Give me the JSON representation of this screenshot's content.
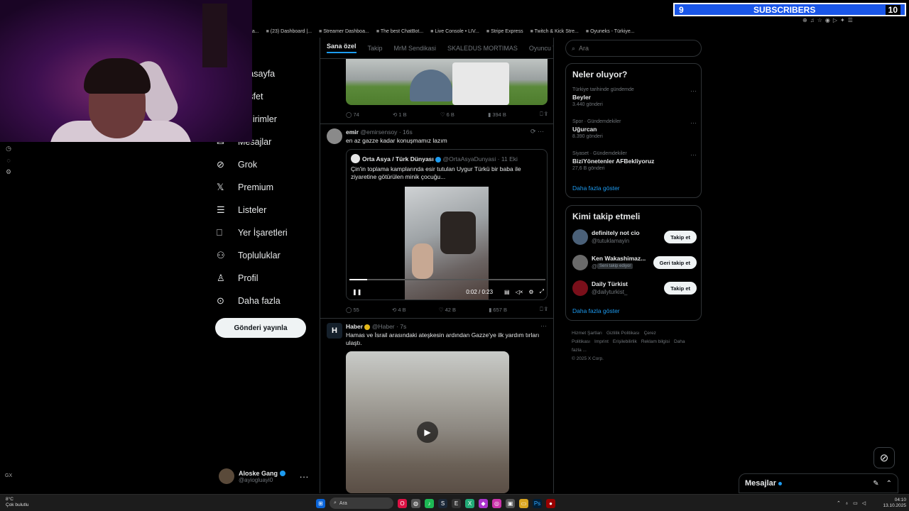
{
  "browser": {
    "bookmarks": [
      "g Strea...",
      "(23) Dashboard |...",
      "Streamer Dashboa...",
      "The best ChatBot...",
      "Live Console • LIV...",
      "Stripe Express",
      "Twitch & Kick Stre...",
      "Oyuneks - Türkiye..."
    ]
  },
  "overlay": {
    "current": "9",
    "label": "SUBSCRIBERS",
    "goal": "10"
  },
  "nav": {
    "items": [
      {
        "label": "Anasayfa",
        "icon": "home-icon"
      },
      {
        "label": "Keşfet",
        "icon": "search-icon"
      },
      {
        "label": "Bildirimler",
        "icon": "bell-icon"
      },
      {
        "label": "Mesajlar",
        "icon": "mail-icon"
      },
      {
        "label": "Grok",
        "icon": "grok-icon"
      },
      {
        "label": "Premium",
        "icon": "x-logo-icon"
      },
      {
        "label": "Listeler",
        "icon": "list-icon"
      },
      {
        "label": "Yer İşaretleri",
        "icon": "bookmark-icon"
      },
      {
        "label": "Topluluklar",
        "icon": "people-icon"
      },
      {
        "label": "Profil",
        "icon": "person-icon"
      },
      {
        "label": "Daha fazla",
        "icon": "more-circle-icon"
      }
    ],
    "post_button": "Gönderi yayınla",
    "account": {
      "name": "Aloske Gang",
      "handle": "@ayiogluayi0"
    }
  },
  "tabs": [
    "Sana özel",
    "Takip",
    "MrM Sendikasi",
    "SKALEDUS MORTIMAS",
    "Oyuncu Topluluğu"
  ],
  "tweets": [
    {
      "stats": {
        "replies": "74",
        "reposts": "1 B",
        "likes": "6 B",
        "views": "394 B"
      }
    },
    {
      "name": "emir",
      "handle": "@emirsensoy",
      "time": "16s",
      "text": "en az gazze kadar konuşmamız lazım",
      "quote": {
        "name": "Orta Asya / Türk Dünyası",
        "handle": "@OrtaAsyaDunyasi",
        "time": "11 Eki",
        "text": "Çin'in toplama kamplarında esir tutulan Uygur Türkü bir baba ile ziyaretine götürülen minik çocuğu...",
        "video_time": "0:02 / 0:23",
        "progress": 0.09
      },
      "stats": {
        "replies": "55",
        "reposts": "4 B",
        "likes": "42 B",
        "views": "657 B"
      }
    },
    {
      "name": "Haber",
      "handle": "@Haber",
      "time": "7s",
      "text": "Hamas ve İsrail arasındaki ateşkesin ardından Gazze'ye ilk yardım tırları ulaştı."
    }
  ],
  "search": {
    "placeholder": "Ara"
  },
  "trends": {
    "title": "Neler oluyor?",
    "items": [
      {
        "context": "Türkiye tarihinde gündemde",
        "topic": "Beyler",
        "posts": "3.440 gönderi"
      },
      {
        "context": "Spor · Gündemdekiler",
        "topic": "Uğurcan",
        "posts": "8.390 gönderi"
      },
      {
        "context": "Siyaset · Gündemdekiler",
        "topic": "BiziYönetenler AFBekliyoruz",
        "posts": "27,6 B gönderi"
      }
    ],
    "show_more": "Daha fazla göster"
  },
  "who_to_follow": {
    "title": "Kimi takip etmeli",
    "items": [
      {
        "name": "definitely not cio",
        "handle": "@tutuklamayin",
        "button": "Takip et"
      },
      {
        "name": "Ken Wakashimaz...",
        "handle": "@W...",
        "badge": "Seni takip ediyor",
        "button": "Geri takip et"
      },
      {
        "name": "Daily Türkist",
        "handle": "@dailyturkist_",
        "button": "Takip et"
      }
    ],
    "show_more": "Daha fazla göster"
  },
  "footer": {
    "links": [
      "Hizmet Şartları",
      "Gizlilik Politikası",
      "Çerez Politikası",
      "Imprint",
      "Erişilebilirlik",
      "Reklam bilgisi",
      "Daha fazla ..."
    ],
    "copyright": "© 2025 X Corp."
  },
  "messages": {
    "title": "Mesajlar"
  },
  "side": {
    "gx": "GX"
  },
  "taskbar": {
    "weather_temp": "8°C",
    "weather_desc": "Çok bulutlu",
    "search": "Ara",
    "time": "04:10",
    "date": "13.10.2025"
  },
  "colors": {
    "accent": "#1d9bf0",
    "overlay": "#1a56e8"
  }
}
